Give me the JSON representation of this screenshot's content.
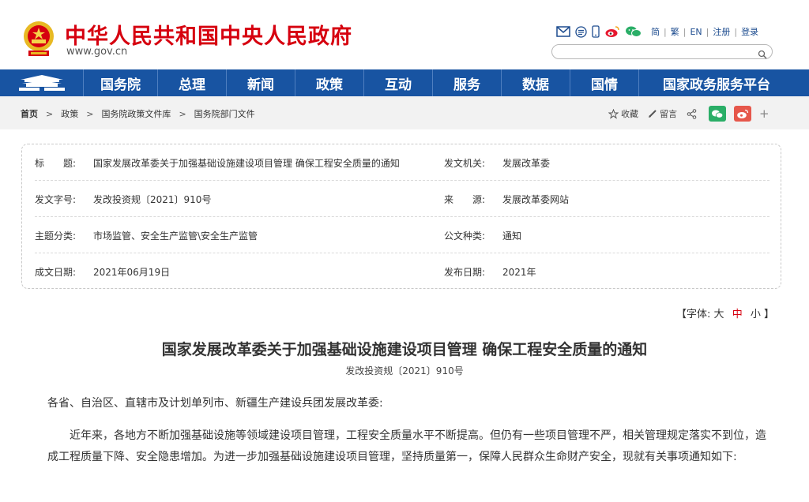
{
  "header": {
    "site_title": "中华人民共和国中央人民政府",
    "site_url": "www.gov.cn",
    "links": [
      "简",
      "繁",
      "EN",
      "注册",
      "登录"
    ],
    "search_placeholder": ""
  },
  "nav": {
    "items": [
      "国务院",
      "总理",
      "新闻",
      "政策",
      "互动",
      "服务",
      "数据",
      "国情",
      "国家政务服务平台"
    ],
    "bg_color": "#1854a2"
  },
  "breadcrumb": {
    "items": [
      "首页",
      "政策",
      "国务院政策文件库",
      "国务院部门文件"
    ]
  },
  "tools": {
    "favorite": "收藏",
    "comment": "留言",
    "plus": "+"
  },
  "info": {
    "title_label": "标　　题:",
    "title_value": "国家发展改革委关于加强基础设施建设项目管理 确保工程安全质量的通知",
    "issuer_label": "发文机关:",
    "issuer_value": "发展改革委",
    "docno_label": "发文字号:",
    "docno_value": "发改投资规〔2021〕910号",
    "source_label": "来　　源:",
    "source_value": "发展改革委网站",
    "topic_label": "主题分类:",
    "topic_value": "市场监管、安全生产监管\\安全生产监管",
    "type_label": "公文种类:",
    "type_value": "通知",
    "date_label": "成文日期:",
    "date_value": "2021年06月19日",
    "pub_label": "发布日期:",
    "pub_value": "2021年"
  },
  "font_switch": {
    "prefix": "【字体:",
    "big": "大",
    "mid": "中",
    "small": "小",
    "suffix": "】"
  },
  "article": {
    "title": "国家发展改革委关于加强基础设施建设项目管理 确保工程安全质量的通知",
    "doc_no": "发改投资规〔2021〕910号",
    "p1": "各省、自治区、直辖市及计划单列市、新疆生产建设兵团发展改革委:",
    "p2": "近年来，各地方不断加强基础设施等领域建设项目管理，工程安全质量水平不断提高。但仍有一些项目管理不严，相关管理规定落实不到位，造成工程质量下降、安全隐患增加。为进一步加强基础设施建设项目管理，坚持质量第一，保障人民群众生命财产安全，现就有关事项通知如下:"
  }
}
